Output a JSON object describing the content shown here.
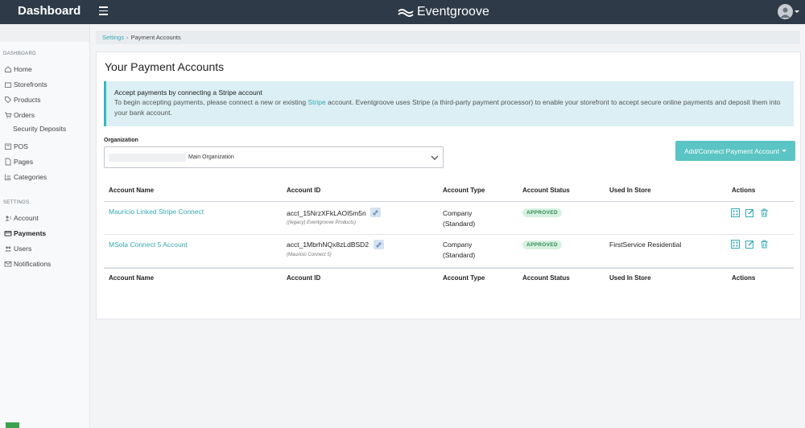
{
  "header": {
    "title": "Dashboard",
    "logo_text": "Eventgroove"
  },
  "sidebar": {
    "section_dashboard": "DASHBOARD",
    "section_settings": "SETTINGS",
    "items": {
      "home": "Home",
      "storefronts": "Storefronts",
      "products": "Products",
      "orders": "Orders",
      "security_deposits": "Security Deposits",
      "pos": "POS",
      "pages": "Pages",
      "categories": "Categories",
      "account": "Account",
      "payments": "Payments",
      "users": "Users",
      "notifications": "Notifications"
    }
  },
  "breadcrumb": {
    "parent": "Settings",
    "current": "Payment Accounts"
  },
  "page": {
    "title": "Your Payment Accounts"
  },
  "alert": {
    "title": "Accept payments by connecting a Stripe account",
    "body_before": "To begin accepting payments, please connect a new or existing ",
    "link": "Stripe",
    "body_after": " account. Eventgroove uses Stripe (a third-party payment processor) to enable your storefront to accept secure online payments and deposit them into your bank account."
  },
  "organization": {
    "label": "Organization",
    "value": "Main Organization"
  },
  "add_button": {
    "label": "Add/Connect Payment Account"
  },
  "table": {
    "columns": [
      "Account Name",
      "Account ID",
      "Account Type",
      "Account Status",
      "Used In Store",
      "Actions"
    ],
    "rows": [
      {
        "name": "Mauricio Linked Stripe Connect",
        "id": "acct_15NrzXFkLAOI5m5n",
        "id_note": "((legacy) Eventgroove Products)",
        "type_line1": "Company",
        "type_line2": "(Standard)",
        "status": "APPROVED",
        "store": ""
      },
      {
        "name": "MSola Connect 5 Account",
        "id": "acct_1MbrhNQx8zLdBSD2",
        "id_note": "(Mauricio Connect 5)",
        "type_line1": "Company",
        "type_line2": "(Standard)",
        "status": "APPROVED",
        "store": "FirstService Residential"
      }
    ]
  },
  "colors": {
    "topbar": "#2e3a47",
    "accent": "#37a9b4",
    "button": "#5bc4c5",
    "approved": "#2e8c51"
  }
}
